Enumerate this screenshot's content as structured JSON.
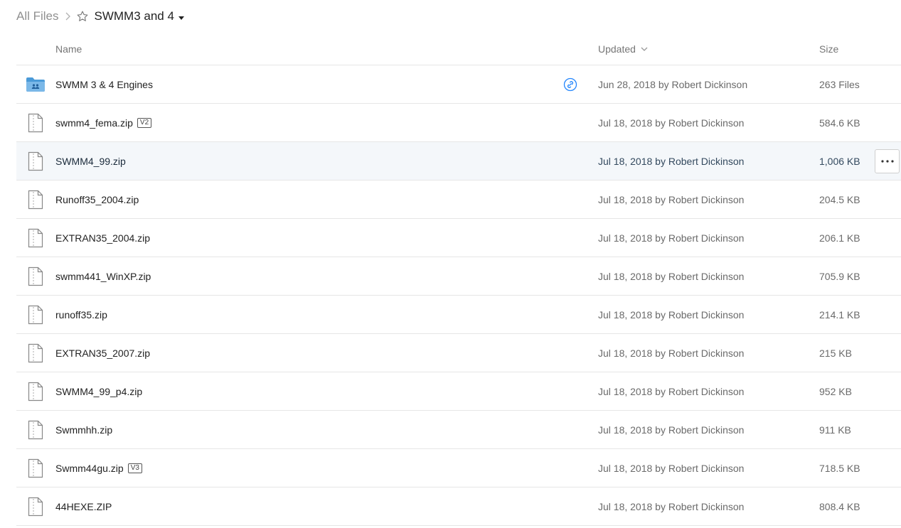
{
  "breadcrumb": {
    "root": "All Files",
    "current": "SWMM3 and 4"
  },
  "columns": {
    "name": "Name",
    "updated": "Updated",
    "size": "Size"
  },
  "rows": [
    {
      "name": "SWMM 3 & 4 Engines",
      "icon": "shared-folder-icon",
      "version": "",
      "has_link": true,
      "updated": "Jun 28, 2018 by Robert Dickinson",
      "size": "263 Files"
    },
    {
      "name": "swmm4_fema.zip",
      "icon": "file-icon",
      "version": "V2",
      "updated": "Jul 18, 2018 by Robert Dickinson",
      "size": "584.6 KB"
    },
    {
      "name": "SWMM4_99.zip",
      "icon": "file-icon",
      "version": "",
      "hovered": true,
      "updated": "Jul 18, 2018 by Robert Dickinson",
      "size": "1,006 KB"
    },
    {
      "name": "Runoff35_2004.zip",
      "icon": "file-icon",
      "version": "",
      "updated": "Jul 18, 2018 by Robert Dickinson",
      "size": "204.5 KB"
    },
    {
      "name": "EXTRAN35_2004.zip",
      "icon": "file-icon",
      "version": "",
      "updated": "Jul 18, 2018 by Robert Dickinson",
      "size": "206.1 KB"
    },
    {
      "name": "swmm441_WinXP.zip",
      "icon": "file-icon",
      "version": "",
      "updated": "Jul 18, 2018 by Robert Dickinson",
      "size": "705.9 KB"
    },
    {
      "name": "runoff35.zip",
      "icon": "file-icon",
      "version": "",
      "updated": "Jul 18, 2018 by Robert Dickinson",
      "size": "214.1 KB"
    },
    {
      "name": "EXTRAN35_2007.zip",
      "icon": "file-icon",
      "version": "",
      "updated": "Jul 18, 2018 by Robert Dickinson",
      "size": "215 KB"
    },
    {
      "name": "SWMM4_99_p4.zip",
      "icon": "file-icon",
      "version": "",
      "updated": "Jul 18, 2018 by Robert Dickinson",
      "size": "952 KB"
    },
    {
      "name": "Swmmhh.zip",
      "icon": "file-icon",
      "version": "",
      "updated": "Jul 18, 2018 by Robert Dickinson",
      "size": "911 KB"
    },
    {
      "name": "Swmm44gu.zip",
      "icon": "file-icon",
      "version": "V3",
      "updated": "Jul 18, 2018 by Robert Dickinson",
      "size": "718.5 KB"
    },
    {
      "name": "44HEXE.ZIP",
      "icon": "file-icon",
      "version": "",
      "updated": "Jul 18, 2018 by Robert Dickinson",
      "size": "808.4 KB"
    }
  ],
  "colors": {
    "folder": "#4a9ad8",
    "link": "#2486fc",
    "hover_row": "#f4f7fa",
    "divider": "#e6e6e6"
  }
}
